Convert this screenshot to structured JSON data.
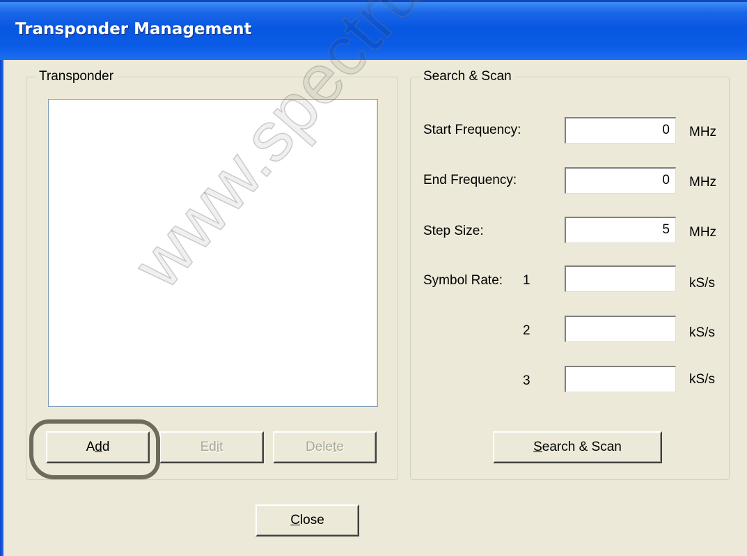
{
  "window": {
    "title": "Transponder Management"
  },
  "transponder_group": {
    "legend": "Transponder",
    "list_items": [],
    "buttons": {
      "add": {
        "pre": "A",
        "mnemonic": "d",
        "post": "d"
      },
      "edit": {
        "pre": "Ed",
        "mnemonic": "i",
        "post": "t"
      },
      "delete": {
        "pre": "Dele",
        "mnemonic": "t",
        "post": "e"
      }
    }
  },
  "search_group": {
    "legend": "Search & Scan",
    "start_frequency": {
      "label": "Start Frequency:",
      "value": "0",
      "unit": "MHz"
    },
    "end_frequency": {
      "label": "End Frequency:",
      "value": "0",
      "unit": "MHz"
    },
    "step_size": {
      "label": "Step Size:",
      "value": "5",
      "unit": "MHz"
    },
    "symbol_rate": {
      "label": "Symbol Rate:",
      "rows": [
        {
          "index": "1",
          "value": "",
          "unit": "kS/s"
        },
        {
          "index": "2",
          "value": "",
          "unit": "kS/s"
        },
        {
          "index": "3",
          "value": "",
          "unit": "kS/s"
        }
      ]
    },
    "search_button": {
      "pre": "",
      "mnemonic": "S",
      "post": "earch & Scan"
    }
  },
  "close_button": {
    "pre": "",
    "mnemonic": "C",
    "post": "lose"
  },
  "watermark": "www.spectrumsat.net",
  "highlight_color": "#6e6a5c"
}
